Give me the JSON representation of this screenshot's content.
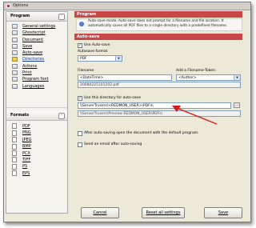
{
  "window": {
    "title": "Options"
  },
  "program_section": {
    "title": "Program",
    "items": [
      {
        "label": "General settings"
      },
      {
        "label": "Ghostscript"
      },
      {
        "label": "Document"
      },
      {
        "label": "Save"
      },
      {
        "label": "Auto-save"
      },
      {
        "label": "Directories"
      },
      {
        "label": "Actions"
      },
      {
        "label": "Print"
      },
      {
        "label": "Program font"
      },
      {
        "label": "Languages"
      }
    ]
  },
  "formats_section": {
    "title": "Formats",
    "items": [
      {
        "label": "PDF"
      },
      {
        "label": "PNG"
      },
      {
        "label": "JPEG"
      },
      {
        "label": "BMP"
      },
      {
        "label": "PCX"
      },
      {
        "label": "TIFF"
      },
      {
        "label": "PS"
      },
      {
        "label": "EPS"
      }
    ]
  },
  "program_panel": {
    "header": "Program",
    "info_text": "Auto-save mode. Auto-save does not prompt for a filename and file location. It automatically saves all PDF files to a single directory with a predefined filename."
  },
  "autosave_panel": {
    "header": "Auto-save",
    "use_autosave_label": "Use Auto-save",
    "format_label": "Autosave format",
    "format_value": "PDF",
    "filename_label": "Filename",
    "filename_value": "<DateTime>",
    "token_label": "Add a Filename-Token:",
    "token_value": "<Author>",
    "filename_preview": "20080225101202.pdf",
    "use_dir_label": "Use this directory for auto-save",
    "dir_value": "\\\\ServerTrusers\\<REDMON_USER>\\PDFs\\",
    "dir_browse": "...",
    "dir_preview": "\\\\ServerTrusers\\Preview REDMON_USER\\PDFs\\",
    "open_after_label": "After auto-saving open the document with the default program.",
    "email_label": "Send an email after auto-saving"
  },
  "buttons": {
    "cancel": "Cancel",
    "reset": "Reset all settings",
    "save": "Save"
  },
  "colors": {
    "header_red": "#c84848",
    "annotation_arrow": "#d41a1a"
  }
}
